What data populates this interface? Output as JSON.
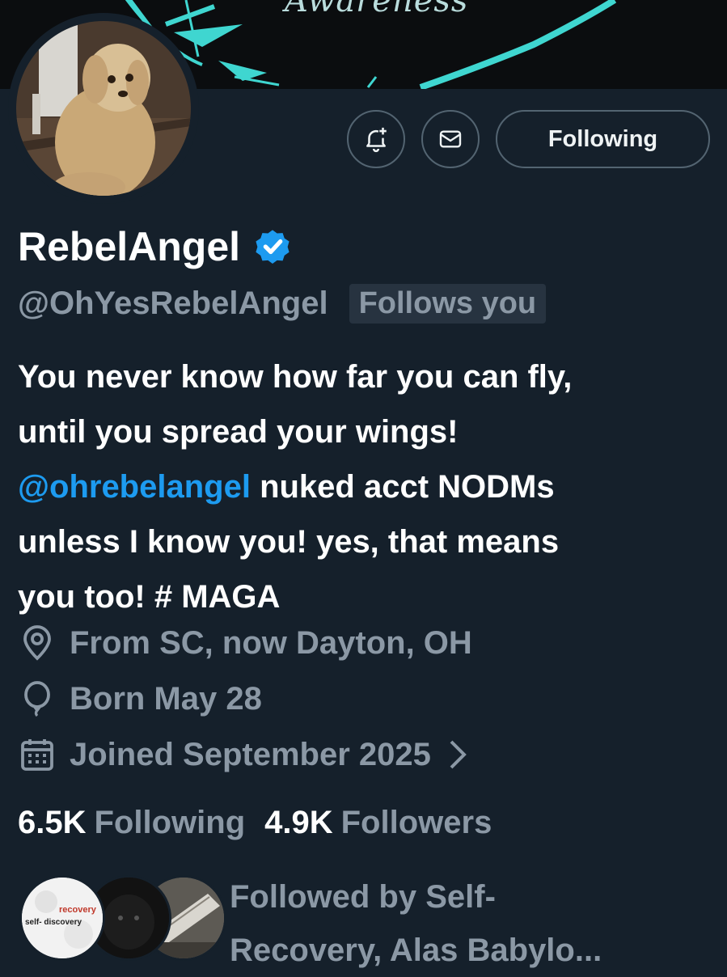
{
  "banner": {
    "text": "Awareness"
  },
  "actions": {
    "notify_icon": "bell-plus-icon",
    "message_icon": "envelope-icon",
    "follow_label": "Following"
  },
  "profile": {
    "display_name": "RebelAngel",
    "verified_icon": "verified-badge-icon",
    "verified_color": "#1d9bf0",
    "handle": "@OhYesRebelAngel",
    "follows_you": "Follows you",
    "bio": {
      "line1": "You never know how far you can fly,",
      "line2": "until you spread your wings!",
      "mention": "@ohrebelangel",
      "line3_rest": " nuked acct NODMs",
      "line4": "unless I know you! yes, that means",
      "line5": "you too! # MAGA"
    },
    "location": "From SC, now Dayton, OH",
    "birthday": "Born May 28",
    "joined": "Joined September 2025",
    "joined_chevron": "›"
  },
  "counts": {
    "following_num": "6.5K",
    "following_label": "Following",
    "followers_num": "4.9K",
    "followers_label": "Followers"
  },
  "followed_by": {
    "line1": "Followed by Self-",
    "line2": "Recovery, Alas Babylo...",
    "avatar1_text_top": "recovery",
    "avatar1_text_bottom": "self- discovery"
  },
  "colors": {
    "background": "#15202b",
    "secondary_text": "#8b98a5",
    "accent": "#1d9bf0",
    "banner_teal": "#3fd6d0"
  }
}
